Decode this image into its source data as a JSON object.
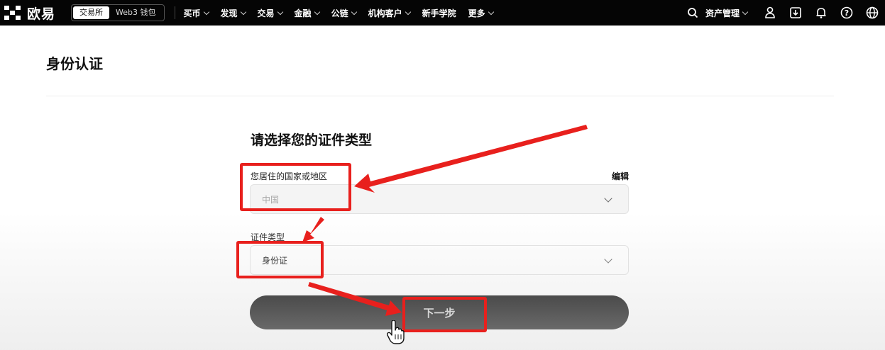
{
  "brand": {
    "name": "欧易"
  },
  "topbar": {
    "segment": {
      "active": "交易所",
      "inactive": "Web3 钱包"
    },
    "nav": [
      {
        "label": "买币",
        "dropdown": true
      },
      {
        "label": "发现",
        "dropdown": true
      },
      {
        "label": "交易",
        "dropdown": true
      },
      {
        "label": "金融",
        "dropdown": true
      },
      {
        "label": "公链",
        "dropdown": true
      },
      {
        "label": "机构客户",
        "dropdown": true
      },
      {
        "label": "新手学院",
        "dropdown": false
      },
      {
        "label": "更多",
        "dropdown": true
      }
    ],
    "asset_label": "资产管理",
    "icons": [
      "search-icon",
      "user-icon",
      "download-icon",
      "bell-icon",
      "help-icon",
      "globe-icon"
    ]
  },
  "page": {
    "title": "身份认证",
    "form_title": "请选择您的证件类型",
    "country": {
      "label": "您居住的国家或地区",
      "edit": "编辑",
      "value": "中国"
    },
    "id_type": {
      "label": "证件类型",
      "value": "身份证"
    },
    "next_button": "下一步"
  },
  "colors": {
    "topbar": "#050505",
    "annotation": "#e8201d",
    "button": "#000000"
  }
}
